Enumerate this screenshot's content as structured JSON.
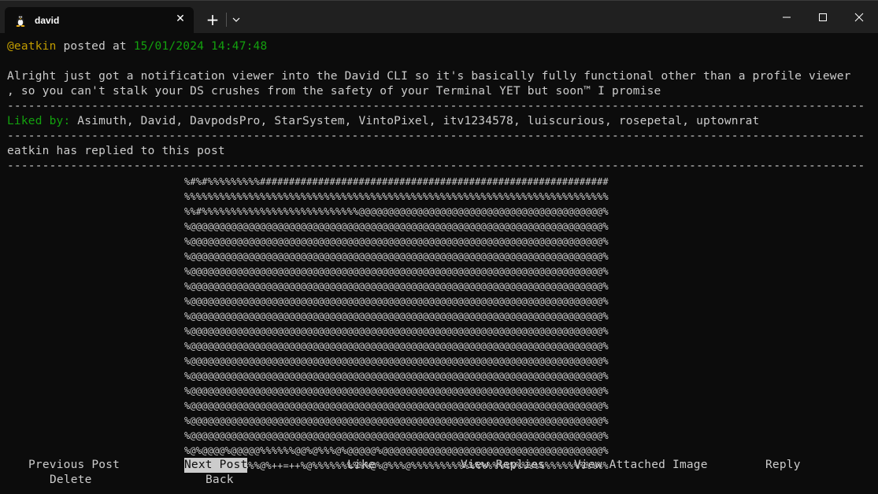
{
  "window": {
    "tab_title": "david",
    "tab_icon": "linux-tux-icon",
    "tab_close_glyph": "✕",
    "new_tab_glyph": "+"
  },
  "post": {
    "author": "@eatkin",
    "posted_at_label": " posted at ",
    "timestamp": "15/01/2024 14:47:48",
    "body_lines": [
      "Alright just got a notification viewer into the David CLI so it's basically fully functional other than a profile viewer",
      ", so you can't stalk your DS crushes from the safety of your Terminal YET but soon™ I promise"
    ],
    "separator": "--------------------------------------------------------------------------------------------------------------------------",
    "liked_by_label": "Liked by:",
    "liked_by_users": " Asimuth, David, DavpodsPro, StarSystem, VintoPixel, itv1234578, luiscurious, rosepetal, uptownrat",
    "reply_notice": "eatkin has replied to this post"
  },
  "image_ascii": "%#%#%%%%%%%%%############################################################\n%%%%%%%%%%%%%%%%%%%%%%%%%%%%%%%%%%%%%%%%%%%%%%%%%%%%%%%%%%%%%%%%%%%%%%%%%\n%%#%%%%%%%%%%%%%%%%%%%%%%%%%%%@@@@@@@@@@@@@@@@@@@@@@@@@@@@@@@@@@@@@@@@@@%\n%@@@@@@@@@@@@@@@@@@@@@@@@@@@@@@@@@@@@@@@@@@@@@@@@@@@@@@@@@@@@@@@@@@@@@@@%\n%@@@@@@@@@@@@@@@@@@@@@@@@@@@@@@@@@@@@@@@@@@@@@@@@@@@@@@@@@@@@@@@@@@@@@@@%\n%@@@@@@@@@@@@@@@@@@@@@@@@@@@@@@@@@@@@@@@@@@@@@@@@@@@@@@@@@@@@@@@@@@@@@@@%\n%@@@@@@@@@@@@@@@@@@@@@@@@@@@@@@@@@@@@@@@@@@@@@@@@@@@@@@@@@@@@@@@@@@@@@@@%\n%@@@@@@@@@@@@@@@@@@@@@@@@@@@@@@@@@@@@@@@@@@@@@@@@@@@@@@@@@@@@@@@@@@@@@@@%\n%@@@@@@@@@@@@@@@@@@@@@@@@@@@@@@@@@@@@@@@@@@@@@@@@@@@@@@@@@@@@@@@@@@@@@@@%\n%@@@@@@@@@@@@@@@@@@@@@@@@@@@@@@@@@@@@@@@@@@@@@@@@@@@@@@@@@@@@@@@@@@@@@@@%\n%@@@@@@@@@@@@@@@@@@@@@@@@@@@@@@@@@@@@@@@@@@@@@@@@@@@@@@@@@@@@@@@@@@@@@@@%\n%@@@@@@@@@@@@@@@@@@@@@@@@@@@@@@@@@@@@@@@@@@@@@@@@@@@@@@@@@@@@@@@@@@@@@@@%\n%@@@@@@@@@@@@@@@@@@@@@@@@@@@@@@@@@@@@@@@@@@@@@@@@@@@@@@@@@@@@@@@@@@@@@@@%\n%@@@@@@@@@@@@@@@@@@@@@@@@@@@@@@@@@@@@@@@@@@@@@@@@@@@@@@@@@@@@@@@@@@@@@@@%\n%@@@@@@@@@@@@@@@@@@@@@@@@@@@@@@@@@@@@@@@@@@@@@@@@@@@@@@@@@@@@@@@@@@@@@@@%\n%@@@@@@@@@@@@@@@@@@@@@@@@@@@@@@@@@@@@@@@@@@@@@@@@@@@@@@@@@@@@@@@@@@@@@@@%\n%@@@@@@@@@@@@@@@@@@@@@@@@@@@@@@@@@@@@@@@@@@@@@@@@@@@@@@@@@@@@@@@@@@@@@@@%\n%@@@@@@@@@@@@@@@@@@@@@@@@@@@@@@@@@@@@@@@@@@@@@@@@@@@@@@@@@@@@@@@@@@@@@@@%\n%@%@@@@%@@@@@%%%%%%@@%@%%%@%@@@@@%@@@@@@@@@@@@@@@@@@@@@@@@@@@@@@@@@@@@@@%\n%%%%%%%%%%%%%@%++=++%@%%%%%%%%%%@%@%%%@%%%%%%%%%%%%%%%%%%%%%%%%%%%%%%%%%%",
  "menu": {
    "previous_post": "Previous Post",
    "next_post": "Next Post",
    "like": "Like",
    "view_replies": "View Replies",
    "view_attached_image": "View Attached Image",
    "reply": "Reply",
    "delete": "Delete",
    "back": "Back",
    "selected": "next_post"
  },
  "colors": {
    "username": "#c19c00",
    "timestamp": "#13a10e",
    "liked_label": "#13a10e",
    "terminal_text": "#cccccc",
    "terminal_bg": "#0c0c0c",
    "titlebar_bg": "#202020"
  }
}
